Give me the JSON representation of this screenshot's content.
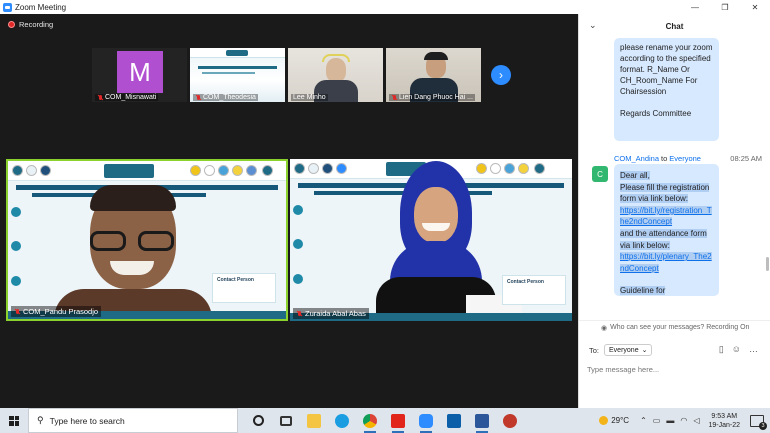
{
  "window": {
    "title": "Zoom Meeting",
    "controls": [
      "—",
      "❐",
      "✕"
    ]
  },
  "meeting": {
    "recording_label": "Recording",
    "thumbnails": [
      {
        "name": "COM_Misnawati",
        "avatar_letter": "M",
        "avatar_color": "#b04fd0",
        "kind": "avatar"
      },
      {
        "name": "COM_Theodesia",
        "kind": "slide"
      },
      {
        "name": "Lee Minho",
        "kind": "person"
      },
      {
        "name": "Lien Dang Phuoc Hai ...",
        "kind": "person"
      }
    ],
    "main_tiles": [
      {
        "name": "COM_Pandu Prasodjo",
        "muted": true,
        "active_speaker": true
      },
      {
        "name": "Zuraida Abal Abas",
        "muted": true,
        "active_speaker": false
      }
    ],
    "slide_text": {
      "contact": "Contact Person"
    },
    "active_speaker_color": "#8bd22f",
    "next_arrow": "›"
  },
  "chat": {
    "title": "Chat",
    "prev_message": {
      "text": "please rename your zoom according to the specified format. R_Name Or CH_Room_Name For Chairsession",
      "signoff": "Regards Committee"
    },
    "message": {
      "avatar_letter": "C",
      "from": "COM_Andina",
      "to_word": "to",
      "to": "Everyone",
      "time": "08:25 AM",
      "lines": [
        "Dear all,",
        "Please fill the registration form via link below:"
      ],
      "link1": "https://bit.ly/registration_The2ndConcept",
      "middle": "and the attendance form via link below:",
      "link2": "https://bit.ly/plenary_The2ndConcept",
      "tail": "Guideline for"
    },
    "visibility_note": "Who can see your messages? Recording On",
    "to_label": "To:",
    "recipient": "Everyone",
    "input_placeholder": "Type message here..."
  },
  "taskbar": {
    "search_placeholder": "Type here to search",
    "weather_temp": "29°C",
    "time": "9:53 AM",
    "date": "19-Jan-22",
    "notification_count": "3",
    "pinned": [
      {
        "name": "task-view",
        "color": "#3a3a3a"
      },
      {
        "name": "file-explorer",
        "color": "#f4c542"
      },
      {
        "name": "edge",
        "color": "#1b9de2"
      },
      {
        "name": "chrome",
        "color": "#db4437"
      },
      {
        "name": "acrobat",
        "color": "#e1251b"
      },
      {
        "name": "zoom",
        "color": "#2d8cff"
      },
      {
        "name": "photos",
        "color": "#0a5fa8"
      },
      {
        "name": "word",
        "color": "#2b579a"
      },
      {
        "name": "snipping",
        "color": "#c0392b"
      }
    ]
  }
}
